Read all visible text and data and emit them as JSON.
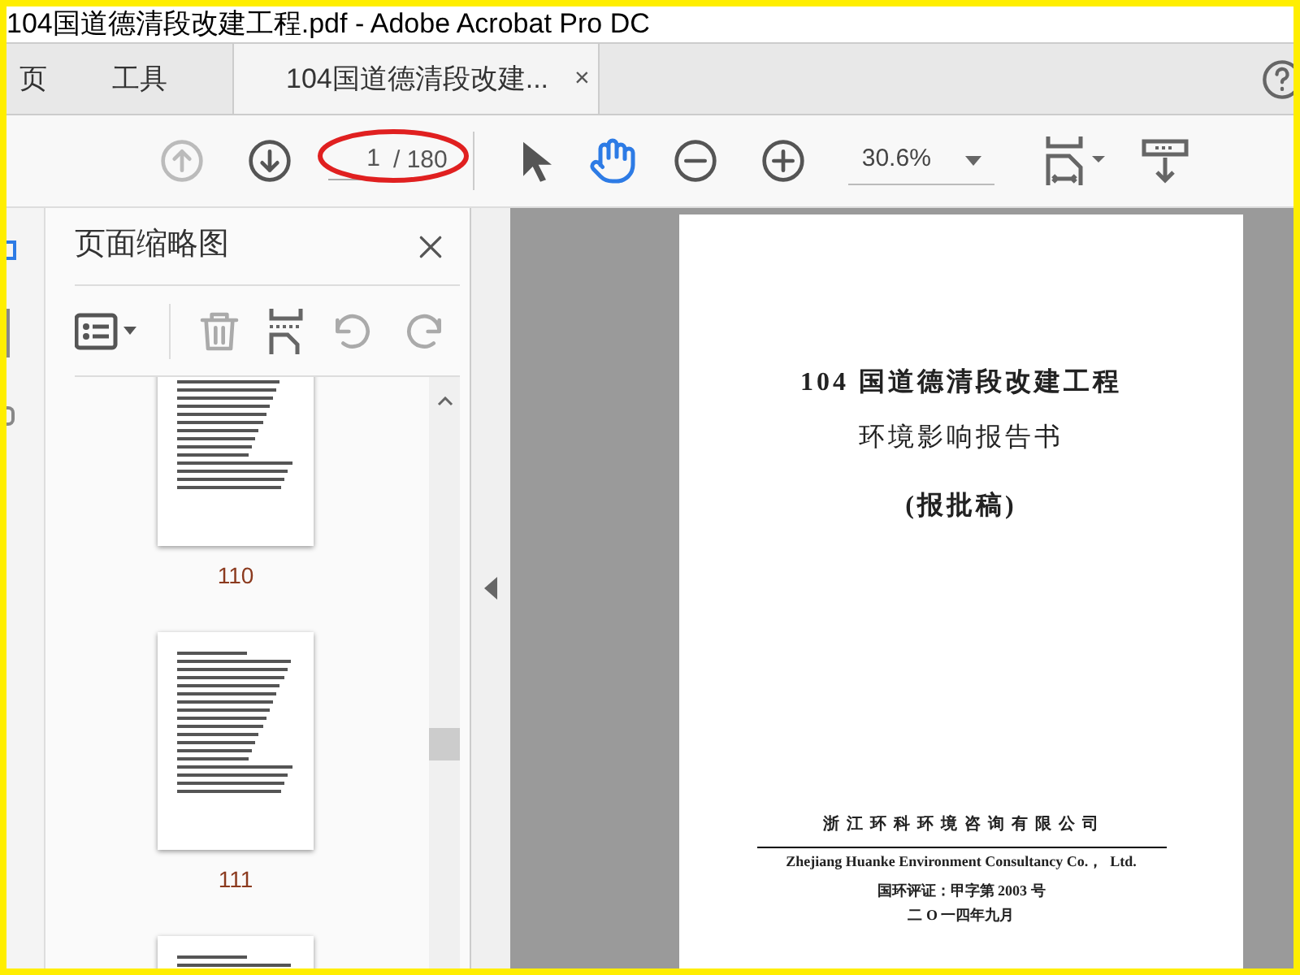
{
  "window": {
    "title": "104国道德清段改建工程.pdf - Adobe Acrobat Pro DC"
  },
  "tabs": [
    {
      "label": "页",
      "selected": false
    },
    {
      "label": "工具",
      "selected": false
    },
    {
      "label": "104国道德清段改建...",
      "selected": true,
      "close": "×"
    }
  ],
  "toolbar": {
    "page_current": "1",
    "page_total": "/ 180",
    "zoom": "30.6%",
    "prev_disabled": true
  },
  "thumbnail_panel": {
    "title": "页面缩略图",
    "pages": [
      {
        "label": "110",
        "selected": false
      },
      {
        "label": "111",
        "selected": false
      },
      {
        "selected": false
      }
    ]
  },
  "document": {
    "title_lines": [
      "104 国道德清段改建工程",
      "环境影响报告书"
    ],
    "subtitle": "(报批稿)",
    "company": "浙 江 环 科 环 境 咨 询 有 限 公 司",
    "company_en": "Zhejiang Huanke Environment Consultancy Co.，  Ltd.",
    "certificate": "国环评证：甲字第 2003 号",
    "date": "二 O 一四年九月"
  }
}
